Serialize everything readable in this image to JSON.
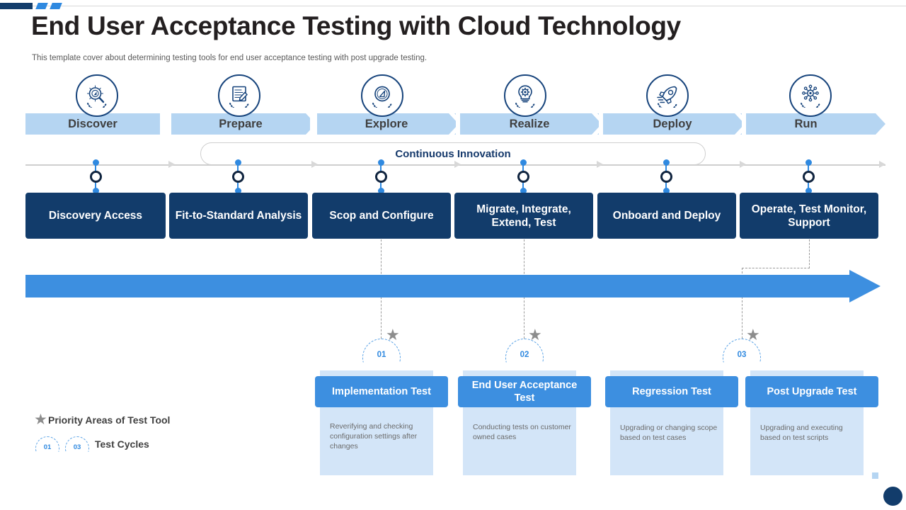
{
  "header": {
    "title": "End User Acceptance Testing with Cloud Technology",
    "subtitle": "This template cover about determining testing tools for end user acceptance testing with post upgrade testing."
  },
  "phases": [
    {
      "label": "Discover",
      "icon": "magnifier-compass-icon"
    },
    {
      "label": "Prepare",
      "icon": "document-edit-icon"
    },
    {
      "label": "Explore",
      "icon": "compass-icon"
    },
    {
      "label": "Realize",
      "icon": "lightbulb-gear-icon"
    },
    {
      "label": "Deploy",
      "icon": "rocket-icon"
    },
    {
      "label": "Run",
      "icon": "network-gear-icon"
    }
  ],
  "continuous_innovation": {
    "label": "Continuous Innovation"
  },
  "phase_boxes": [
    {
      "label": "Discovery Access"
    },
    {
      "label": "Fit-to-Standard Analysis"
    },
    {
      "label": "Scop and Configure"
    },
    {
      "label": "Migrate, Integrate, Extend, Test"
    },
    {
      "label": "Onboard and Deploy"
    },
    {
      "label": "Operate, Test Monitor, Support"
    }
  ],
  "cycle_markers": [
    {
      "number": "01"
    },
    {
      "number": "02"
    },
    {
      "number": "03"
    }
  ],
  "test_cards": [
    {
      "title": "Implementation Test",
      "body": "Reverifying and checking configuration settings after changes"
    },
    {
      "title": "End User Acceptance Test",
      "body": "Conducting tests on customer owned cases"
    },
    {
      "title": "Regression Test",
      "body": "Upgrading or changing scope based on test cases"
    },
    {
      "title": "Post Upgrade Test",
      "body": "Upgrading and executing based on test scripts"
    }
  ],
  "legend": {
    "priority_label": "Priority Areas of Test Tool",
    "cycles_label": "Test Cycles",
    "cycle_badges": [
      "01",
      "03"
    ]
  },
  "colors": {
    "navy": "#123c6b",
    "blue": "#3d8fe0",
    "light_blue_band": "#b5d5f2",
    "card_body_bg": "#d3e5f8",
    "accent_dot": "#2f89e0",
    "gray_star": "#8d8d8d"
  }
}
